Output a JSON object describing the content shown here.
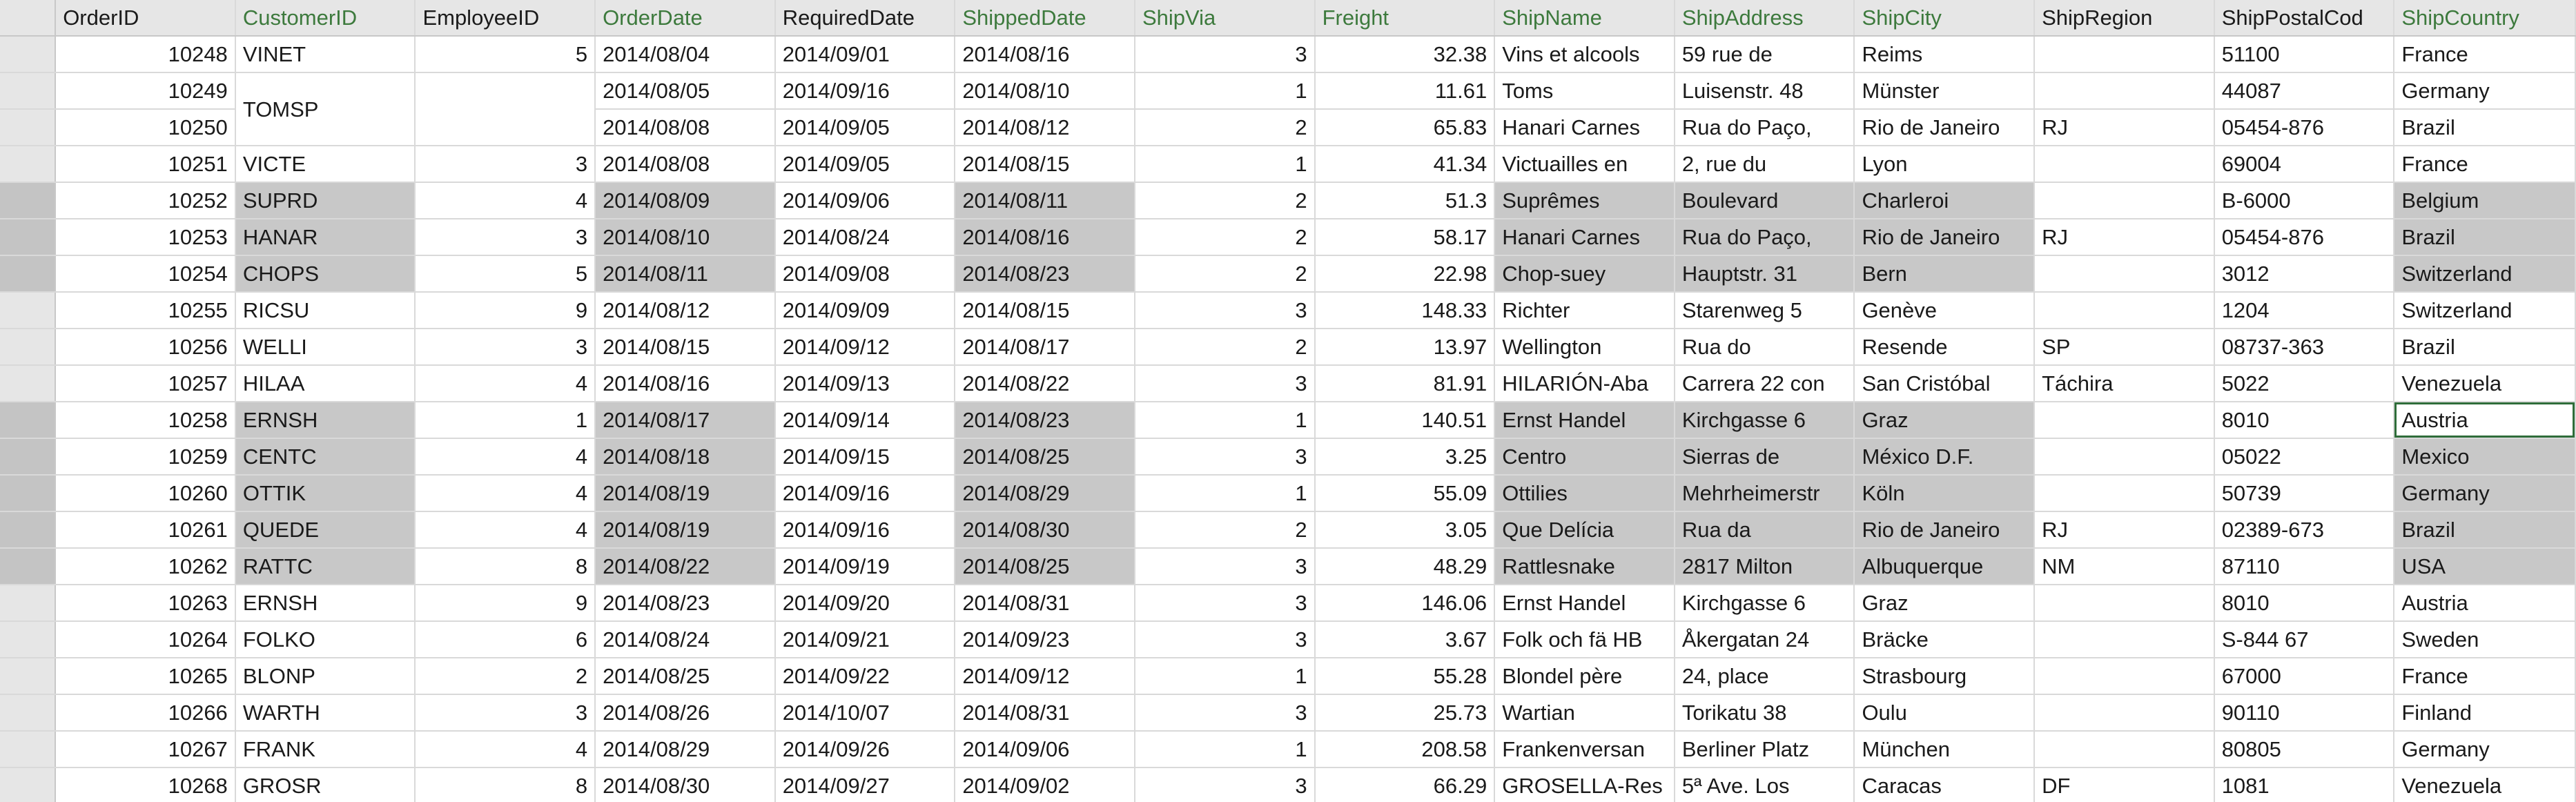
{
  "sheet": {
    "columns": [
      {
        "key": "OrderID",
        "label": "OrderID",
        "highlight": false
      },
      {
        "key": "CustomerID",
        "label": "CustomerID",
        "highlight": true
      },
      {
        "key": "EmployeeID",
        "label": "EmployeeID",
        "highlight": false
      },
      {
        "key": "OrderDate",
        "label": "OrderDate",
        "highlight": true
      },
      {
        "key": "RequiredDate",
        "label": "RequiredDate",
        "highlight": false
      },
      {
        "key": "ShippedDate",
        "label": "ShippedDate",
        "highlight": true
      },
      {
        "key": "ShipVia",
        "label": "ShipVia",
        "highlight": true
      },
      {
        "key": "Freight",
        "label": "Freight",
        "highlight": true
      },
      {
        "key": "ShipName",
        "label": "ShipName",
        "highlight": true
      },
      {
        "key": "ShipAddress",
        "label": "ShipAddress",
        "highlight": true
      },
      {
        "key": "ShipCity",
        "label": "ShipCity",
        "highlight": true
      },
      {
        "key": "ShipRegion",
        "label": "ShipRegion",
        "highlight": false
      },
      {
        "key": "ShipPostalCode",
        "label": "ShipPostalCod",
        "highlight": false
      },
      {
        "key": "ShipCountry",
        "label": "ShipCountry",
        "highlight": true
      }
    ],
    "highlight_text_color": "#3d7a3d",
    "selection_color": "#c8c8c8",
    "rows": [
      {
        "OrderID": "10248",
        "CustomerID": "VINET",
        "EmployeeID": "5",
        "OrderDate": "2014/08/04",
        "RequiredDate": "2014/09/01",
        "ShippedDate": "2014/08/16",
        "ShipVia": "3",
        "Freight": "32.38",
        "ShipName": "Vins et alcools",
        "ShipAddress": "59 rue de",
        "ShipCity": "Reims",
        "ShipRegion": "",
        "ShipPostalCode": "51100",
        "ShipCountry": "France",
        "selected": false
      },
      {
        "OrderID": "10249",
        "CustomerID": "TOMSP",
        "EmployeeID": "",
        "OrderDate": "2014/08/05",
        "RequiredDate": "2014/09/16",
        "ShippedDate": "2014/08/10",
        "ShipVia": "1",
        "Freight": "11.61",
        "ShipName": "Toms",
        "ShipAddress": "Luisenstr. 48",
        "ShipCity": "Münster",
        "ShipRegion": "",
        "ShipPostalCode": "44087",
        "ShipCountry": "Germany",
        "selected": false
      },
      {
        "OrderID": "10250",
        "CustomerID": "",
        "EmployeeID": "",
        "OrderDate": "2014/08/08",
        "RequiredDate": "2014/09/05",
        "ShippedDate": "2014/08/12",
        "ShipVia": "2",
        "Freight": "65.83",
        "ShipName": "Hanari Carnes",
        "ShipAddress": "Rua do Paço,",
        "ShipCity": "Rio de Janeiro",
        "ShipRegion": "RJ",
        "ShipPostalCode": "05454-876",
        "ShipCountry": "Brazil",
        "selected": false
      },
      {
        "OrderID": "10251",
        "CustomerID": "VICTE",
        "EmployeeID": "3",
        "OrderDate": "2014/08/08",
        "RequiredDate": "2014/09/05",
        "ShippedDate": "2014/08/15",
        "ShipVia": "1",
        "Freight": "41.34",
        "ShipName": "Victuailles en",
        "ShipAddress": "2, rue du",
        "ShipCity": "Lyon",
        "ShipRegion": "",
        "ShipPostalCode": "69004",
        "ShipCountry": "France",
        "selected": false
      },
      {
        "OrderID": "10252",
        "CustomerID": "SUPRD",
        "EmployeeID": "4",
        "OrderDate": "2014/08/09",
        "RequiredDate": "2014/09/06",
        "ShippedDate": "2014/08/11",
        "ShipVia": "2",
        "Freight": "51.3",
        "ShipName": "Suprêmes",
        "ShipAddress": "Boulevard",
        "ShipCity": "Charleroi",
        "ShipRegion": "",
        "ShipPostalCode": "B-6000",
        "ShipCountry": "Belgium",
        "selected": true
      },
      {
        "OrderID": "10253",
        "CustomerID": "HANAR",
        "EmployeeID": "3",
        "OrderDate": "2014/08/10",
        "RequiredDate": "2014/08/24",
        "ShippedDate": "2014/08/16",
        "ShipVia": "2",
        "Freight": "58.17",
        "ShipName": "Hanari Carnes",
        "ShipAddress": "Rua do Paço,",
        "ShipCity": "Rio de Janeiro",
        "ShipRegion": "RJ",
        "ShipPostalCode": "05454-876",
        "ShipCountry": "Brazil",
        "selected": true
      },
      {
        "OrderID": "10254",
        "CustomerID": "CHOPS",
        "EmployeeID": "5",
        "OrderDate": "2014/08/11",
        "RequiredDate": "2014/09/08",
        "ShippedDate": "2014/08/23",
        "ShipVia": "2",
        "Freight": "22.98",
        "ShipName": "Chop-suey",
        "ShipAddress": "Hauptstr. 31",
        "ShipCity": "Bern",
        "ShipRegion": "",
        "ShipPostalCode": "3012",
        "ShipCountry": "Switzerland",
        "selected": true
      },
      {
        "OrderID": "10255",
        "CustomerID": "RICSU",
        "EmployeeID": "9",
        "OrderDate": "2014/08/12",
        "RequiredDate": "2014/09/09",
        "ShippedDate": "2014/08/15",
        "ShipVia": "3",
        "Freight": "148.33",
        "ShipName": "Richter",
        "ShipAddress": "Starenweg 5",
        "ShipCity": "Genève",
        "ShipRegion": "",
        "ShipPostalCode": "1204",
        "ShipCountry": "Switzerland",
        "selected": false
      },
      {
        "OrderID": "10256",
        "CustomerID": "WELLI",
        "EmployeeID": "3",
        "OrderDate": "2014/08/15",
        "RequiredDate": "2014/09/12",
        "ShippedDate": "2014/08/17",
        "ShipVia": "2",
        "Freight": "13.97",
        "ShipName": "Wellington",
        "ShipAddress": "Rua do",
        "ShipCity": "Resende",
        "ShipRegion": "SP",
        "ShipPostalCode": "08737-363",
        "ShipCountry": "Brazil",
        "selected": false
      },
      {
        "OrderID": "10257",
        "CustomerID": "HILAA",
        "EmployeeID": "4",
        "OrderDate": "2014/08/16",
        "RequiredDate": "2014/09/13",
        "ShippedDate": "2014/08/22",
        "ShipVia": "3",
        "Freight": "81.91",
        "ShipName": "HILARIÓN-Aba",
        "ShipAddress": "Carrera 22 con",
        "ShipCity": "San Cristóbal",
        "ShipRegion": "Táchira",
        "ShipPostalCode": "5022",
        "ShipCountry": "Venezuela",
        "selected": false
      },
      {
        "OrderID": "10258",
        "CustomerID": "ERNSH",
        "EmployeeID": "1",
        "OrderDate": "2014/08/17",
        "RequiredDate": "2014/09/14",
        "ShippedDate": "2014/08/23",
        "ShipVia": "1",
        "Freight": "140.51",
        "ShipName": "Ernst Handel",
        "ShipAddress": "Kirchgasse 6",
        "ShipCity": "Graz",
        "ShipRegion": "",
        "ShipPostalCode": "8010",
        "ShipCountry": "Austria",
        "selected": true,
        "active": true
      },
      {
        "OrderID": "10259",
        "CustomerID": "CENTC",
        "EmployeeID": "4",
        "OrderDate": "2014/08/18",
        "RequiredDate": "2014/09/15",
        "ShippedDate": "2014/08/25",
        "ShipVia": "3",
        "Freight": "3.25",
        "ShipName": "Centro",
        "ShipAddress": "Sierras de",
        "ShipCity": "México D.F.",
        "ShipRegion": "",
        "ShipPostalCode": "05022",
        "ShipCountry": "Mexico",
        "selected": true
      },
      {
        "OrderID": "10260",
        "CustomerID": "OTTIK",
        "EmployeeID": "4",
        "OrderDate": "2014/08/19",
        "RequiredDate": "2014/09/16",
        "ShippedDate": "2014/08/29",
        "ShipVia": "1",
        "Freight": "55.09",
        "ShipName": "Ottilies",
        "ShipAddress": "Mehrheimerstr",
        "ShipCity": "Köln",
        "ShipRegion": "",
        "ShipPostalCode": "50739",
        "ShipCountry": "Germany",
        "selected": true
      },
      {
        "OrderID": "10261",
        "CustomerID": "QUEDE",
        "EmployeeID": "4",
        "OrderDate": "2014/08/19",
        "RequiredDate": "2014/09/16",
        "ShippedDate": "2014/08/30",
        "ShipVia": "2",
        "Freight": "3.05",
        "ShipName": "Que Delícia",
        "ShipAddress": "Rua da",
        "ShipCity": "Rio de Janeiro",
        "ShipRegion": "RJ",
        "ShipPostalCode": "02389-673",
        "ShipCountry": "Brazil",
        "selected": true
      },
      {
        "OrderID": "10262",
        "CustomerID": "RATTC",
        "EmployeeID": "8",
        "OrderDate": "2014/08/22",
        "RequiredDate": "2014/09/19",
        "ShippedDate": "2014/08/25",
        "ShipVia": "3",
        "Freight": "48.29",
        "ShipName": "Rattlesnake",
        "ShipAddress": "2817 Milton",
        "ShipCity": "Albuquerque",
        "ShipRegion": "NM",
        "ShipPostalCode": "87110",
        "ShipCountry": "USA",
        "selected": true
      },
      {
        "OrderID": "10263",
        "CustomerID": "ERNSH",
        "EmployeeID": "9",
        "OrderDate": "2014/08/23",
        "RequiredDate": "2014/09/20",
        "ShippedDate": "2014/08/31",
        "ShipVia": "3",
        "Freight": "146.06",
        "ShipName": "Ernst Handel",
        "ShipAddress": "Kirchgasse 6",
        "ShipCity": "Graz",
        "ShipRegion": "",
        "ShipPostalCode": "8010",
        "ShipCountry": "Austria",
        "selected": false
      },
      {
        "OrderID": "10264",
        "CustomerID": "FOLKO",
        "EmployeeID": "6",
        "OrderDate": "2014/08/24",
        "RequiredDate": "2014/09/21",
        "ShippedDate": "2014/09/23",
        "ShipVia": "3",
        "Freight": "3.67",
        "ShipName": "Folk och fä HB",
        "ShipAddress": "Åkergatan 24",
        "ShipCity": "Bräcke",
        "ShipRegion": "",
        "ShipPostalCode": "S-844 67",
        "ShipCountry": "Sweden",
        "selected": false
      },
      {
        "OrderID": "10265",
        "CustomerID": "BLONP",
        "EmployeeID": "2",
        "OrderDate": "2014/08/25",
        "RequiredDate": "2014/09/22",
        "ShippedDate": "2014/09/12",
        "ShipVia": "1",
        "Freight": "55.28",
        "ShipName": "Blondel père",
        "ShipAddress": "24, place",
        "ShipCity": "Strasbourg",
        "ShipRegion": "",
        "ShipPostalCode": "67000",
        "ShipCountry": "France",
        "selected": false
      },
      {
        "OrderID": "10266",
        "CustomerID": "WARTH",
        "EmployeeID": "3",
        "OrderDate": "2014/08/26",
        "RequiredDate": "2014/10/07",
        "ShippedDate": "2014/08/31",
        "ShipVia": "3",
        "Freight": "25.73",
        "ShipName": "Wartian",
        "ShipAddress": "Torikatu 38",
        "ShipCity": "Oulu",
        "ShipRegion": "",
        "ShipPostalCode": "90110",
        "ShipCountry": "Finland",
        "selected": false
      },
      {
        "OrderID": "10267",
        "CustomerID": "FRANK",
        "EmployeeID": "4",
        "OrderDate": "2014/08/29",
        "RequiredDate": "2014/09/26",
        "ShippedDate": "2014/09/06",
        "ShipVia": "1",
        "Freight": "208.58",
        "ShipName": "Frankenversan",
        "ShipAddress": "Berliner Platz",
        "ShipCity": "München",
        "ShipRegion": "",
        "ShipPostalCode": "80805",
        "ShipCountry": "Germany",
        "selected": false
      },
      {
        "OrderID": "10268",
        "CustomerID": "GROSR",
        "EmployeeID": "8",
        "OrderDate": "2014/08/30",
        "RequiredDate": "2014/09/27",
        "ShippedDate": "2014/09/02",
        "ShipVia": "3",
        "Freight": "66.29",
        "ShipName": "GROSELLA-Res",
        "ShipAddress": "5ª Ave. Los",
        "ShipCity": "Caracas",
        "ShipRegion": "DF",
        "ShipPostalCode": "1081",
        "ShipCountry": "Venezuela",
        "selected": false
      }
    ]
  }
}
